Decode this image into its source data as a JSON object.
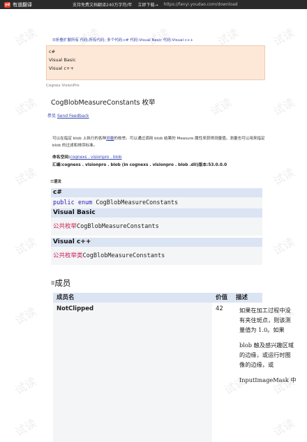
{
  "topbar": {
    "logo_badge": "yd",
    "logo_text": "有道翻译",
    "promo": "支持免费文档翻译240万字符/年",
    "download": "立即下载→",
    "url": "https://fanyi.youdao.com/download"
  },
  "watermark": "试读",
  "breadcrumb": "☰折叠扩展所有  代码:所有代码; 多个代码:c# 代码:Visual Basic 代码:Visual c++",
  "languages": [
    "c#",
    "Visual Basic",
    "Visual c++"
  ],
  "product": "Cognex VisionPro",
  "title": "CogBlobMeasureConstants 枚举",
  "feedback": {
    "prefix": "参见",
    "link": "Send Feedback"
  },
  "description": {
    "part1": "可以在指定 blob 上执行的各种",
    "link": "测量",
    "part2": "的枚举。可以通过调用 blob 结果的 Measure 属性来获得测量值。测量也可以用来指定 blob 的过滤和排序标准。"
  },
  "namespace": {
    "label": "命名空间:",
    "link": "cognexs . visionpro . blob"
  },
  "assembly": "汇编:cognexs . visionpro . blob (in cognexs . visionpro . blob .dll)版本:53.0.0.0",
  "syntax_heading": "☰语法",
  "code_blocks": [
    {
      "lang": "c#",
      "kw": "public enum",
      "name": "CogBlobMeasureConstants"
    },
    {
      "lang": "Visual Basic",
      "kw": "公共枚举",
      "name": "CogBlobMeasureConstants"
    },
    {
      "lang": "Visual c++",
      "kw": "公共枚举类",
      "name": "CogBlobMeasureConstants"
    }
  ],
  "members_heading": {
    "icon": "☰",
    "text": "成员"
  },
  "members_table": {
    "headers": [
      "成员名",
      "价值",
      "描述"
    ],
    "rows": [
      {
        "name": "NotClipped",
        "value": "42",
        "description": [
          "如果在加工过程中没",
          "有夹住斑点，则该测",
          "量值为 1.0。如果",
          "",
          "blob 触及感兴趣区域",
          "的边缘，或运行时图",
          "像的边缘，或",
          "",
          "InputImageMask 中"
        ]
      }
    ]
  }
}
